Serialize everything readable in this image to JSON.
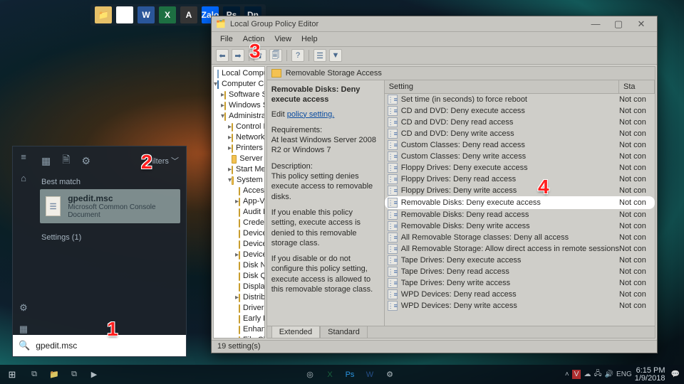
{
  "float_icons": [
    "📁",
    "◎",
    "W",
    "X",
    "A",
    "Zalo",
    "Ps",
    "Dn"
  ],
  "gpe": {
    "title": "Local Group Policy Editor",
    "menus": [
      "File",
      "Action",
      "View",
      "Help"
    ],
    "tree": [
      {
        "ind": 0,
        "caret": "",
        "icon": "x",
        "label": "Local Computer Policy"
      },
      {
        "ind": 0,
        "caret": "▾",
        "icon": "p",
        "label": "Computer Configuration"
      },
      {
        "ind": 1,
        "caret": "▸",
        "icon": "f",
        "label": "Software Settings"
      },
      {
        "ind": 1,
        "caret": "▸",
        "icon": "f",
        "label": "Windows Settings"
      },
      {
        "ind": 1,
        "caret": "▾",
        "icon": "f",
        "label": "Administrative Templates"
      },
      {
        "ind": 2,
        "caret": "▸",
        "icon": "f",
        "label": "Control Panel"
      },
      {
        "ind": 2,
        "caret": "▸",
        "icon": "f",
        "label": "Network"
      },
      {
        "ind": 2,
        "caret": "▸",
        "icon": "f",
        "label": "Printers"
      },
      {
        "ind": 2,
        "caret": "",
        "icon": "f",
        "label": "Server"
      },
      {
        "ind": 2,
        "caret": "▸",
        "icon": "f",
        "label": "Start Menu and Taskbar"
      },
      {
        "ind": 2,
        "caret": "▾",
        "icon": "f",
        "label": "System"
      },
      {
        "ind": 3,
        "caret": "",
        "icon": "f",
        "label": "Access-Denied Assistance"
      },
      {
        "ind": 3,
        "caret": "▸",
        "icon": "f",
        "label": "App-V"
      },
      {
        "ind": 3,
        "caret": "",
        "icon": "f",
        "label": "Audit Process Creation"
      },
      {
        "ind": 3,
        "caret": "",
        "icon": "f",
        "label": "Credentials Delegation"
      },
      {
        "ind": 3,
        "caret": "",
        "icon": "f",
        "label": "Device Guard"
      },
      {
        "ind": 3,
        "caret": "",
        "icon": "f",
        "label": "Device Health Attestation Service"
      },
      {
        "ind": 3,
        "caret": "▸",
        "icon": "f",
        "label": "Device Installation"
      },
      {
        "ind": 3,
        "caret": "",
        "icon": "f",
        "label": "Disk NV Cache"
      },
      {
        "ind": 3,
        "caret": "",
        "icon": "f",
        "label": "Disk Quotas"
      },
      {
        "ind": 3,
        "caret": "",
        "icon": "f",
        "label": "Display"
      },
      {
        "ind": 3,
        "caret": "▸",
        "icon": "f",
        "label": "Distributed COM"
      },
      {
        "ind": 3,
        "caret": "",
        "icon": "f",
        "label": "Driver Installation"
      },
      {
        "ind": 3,
        "caret": "",
        "icon": "f",
        "label": "Early Launch Antimalware"
      },
      {
        "ind": 3,
        "caret": "",
        "icon": "f",
        "label": "Enhanced Storage Access"
      },
      {
        "ind": 3,
        "caret": "",
        "icon": "f",
        "label": "File Classification Infrastructure"
      }
    ],
    "header": "Removable Storage Access",
    "desc": {
      "title": "Removable Disks: Deny execute access",
      "edit": "Edit ",
      "editlink": "policy setting.",
      "req_h": "Requirements:",
      "req": "At least Windows Server 2008 R2 or Windows 7",
      "desc_h": "Description:",
      "desc": "This policy setting denies execute access to removable disks.",
      "p1": "If you enable this policy setting, execute access is denied to this removable storage class.",
      "p2": "If you disable or do not configure this policy setting, execute access is allowed to this removable storage class."
    },
    "cols": {
      "setting": "Setting",
      "state": "Sta"
    },
    "rows": [
      {
        "t": "Set time (in seconds) to force reboot",
        "s": "Not con",
        "hl": false
      },
      {
        "t": "CD and DVD: Deny execute access",
        "s": "Not con",
        "hl": false
      },
      {
        "t": "CD and DVD: Deny read access",
        "s": "Not con",
        "hl": false
      },
      {
        "t": "CD and DVD: Deny write access",
        "s": "Not con",
        "hl": false
      },
      {
        "t": "Custom Classes: Deny read access",
        "s": "Not con",
        "hl": false
      },
      {
        "t": "Custom Classes: Deny write access",
        "s": "Not con",
        "hl": false
      },
      {
        "t": "Floppy Drives: Deny execute access",
        "s": "Not con",
        "hl": false
      },
      {
        "t": "Floppy Drives: Deny read access",
        "s": "Not con",
        "hl": false
      },
      {
        "t": "Floppy Drives: Deny write access",
        "s": "Not con",
        "hl": false
      },
      {
        "t": "Removable Disks: Deny execute access",
        "s": "Not con",
        "hl": true
      },
      {
        "t": "Removable Disks: Deny read access",
        "s": "Not con",
        "hl": false
      },
      {
        "t": "Removable Disks: Deny write access",
        "s": "Not con",
        "hl": false
      },
      {
        "t": "All Removable Storage classes: Deny all access",
        "s": "Not con",
        "hl": false
      },
      {
        "t": "All Removable Storage: Allow direct access in remote sessions",
        "s": "Not con",
        "hl": false
      },
      {
        "t": "Tape Drives: Deny execute access",
        "s": "Not con",
        "hl": false
      },
      {
        "t": "Tape Drives: Deny read access",
        "s": "Not con",
        "hl": false
      },
      {
        "t": "Tape Drives: Deny write access",
        "s": "Not con",
        "hl": false
      },
      {
        "t": "WPD Devices: Deny read access",
        "s": "Not con",
        "hl": false
      },
      {
        "t": "WPD Devices: Deny write access",
        "s": "Not con",
        "hl": false
      }
    ],
    "tabs": {
      "ext": "Extended",
      "std": "Standard"
    },
    "status": "19 setting(s)"
  },
  "search": {
    "filters": "Filters",
    "best": "Best match",
    "result_title": "gpedit.msc",
    "result_sub": "Microsoft Common Console Document",
    "settings": "Settings (1)",
    "value": "gpedit.msc"
  },
  "taskbar": {
    "time": "6:15 PM",
    "date": "1/9/2018",
    "lang": "ENG"
  },
  "steps": {
    "s1": "1",
    "s2": "2",
    "s3": "3",
    "s4": "4"
  }
}
